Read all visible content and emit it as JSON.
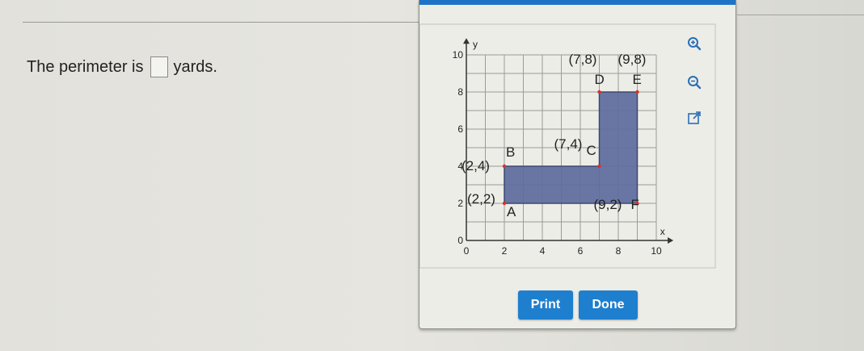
{
  "question": {
    "prefix": "The perimeter is",
    "suffix": "yards."
  },
  "graph": {
    "axis_x_label": "x",
    "axis_y_label": "y",
    "x_ticks": [
      "0",
      "2",
      "4",
      "6",
      "8",
      "10"
    ],
    "y_ticks": [
      "0",
      "2",
      "4",
      "6",
      "8",
      "10"
    ],
    "shape_color": "#5d6b9c",
    "point_color": "#d9302a",
    "points": [
      {
        "name": "A",
        "coord_label": "(2,2)",
        "x": 2,
        "y": 2
      },
      {
        "name": "B",
        "coord_label": "(2,4)",
        "x": 2,
        "y": 4
      },
      {
        "name": "C",
        "coord_label": "(7,4)",
        "x": 7,
        "y": 4
      },
      {
        "name": "D",
        "coord_label": "(7,8)",
        "x": 7,
        "y": 8
      },
      {
        "name": "E",
        "coord_label": "(9,8)",
        "x": 9,
        "y": 8
      },
      {
        "name": "F",
        "coord_label": "(9,2)",
        "x": 9,
        "y": 2
      }
    ]
  },
  "tools": [
    "zoom-in-icon",
    "zoom-out-icon",
    "expand-icon"
  ],
  "buttons": {
    "print": "Print",
    "done": "Done"
  }
}
